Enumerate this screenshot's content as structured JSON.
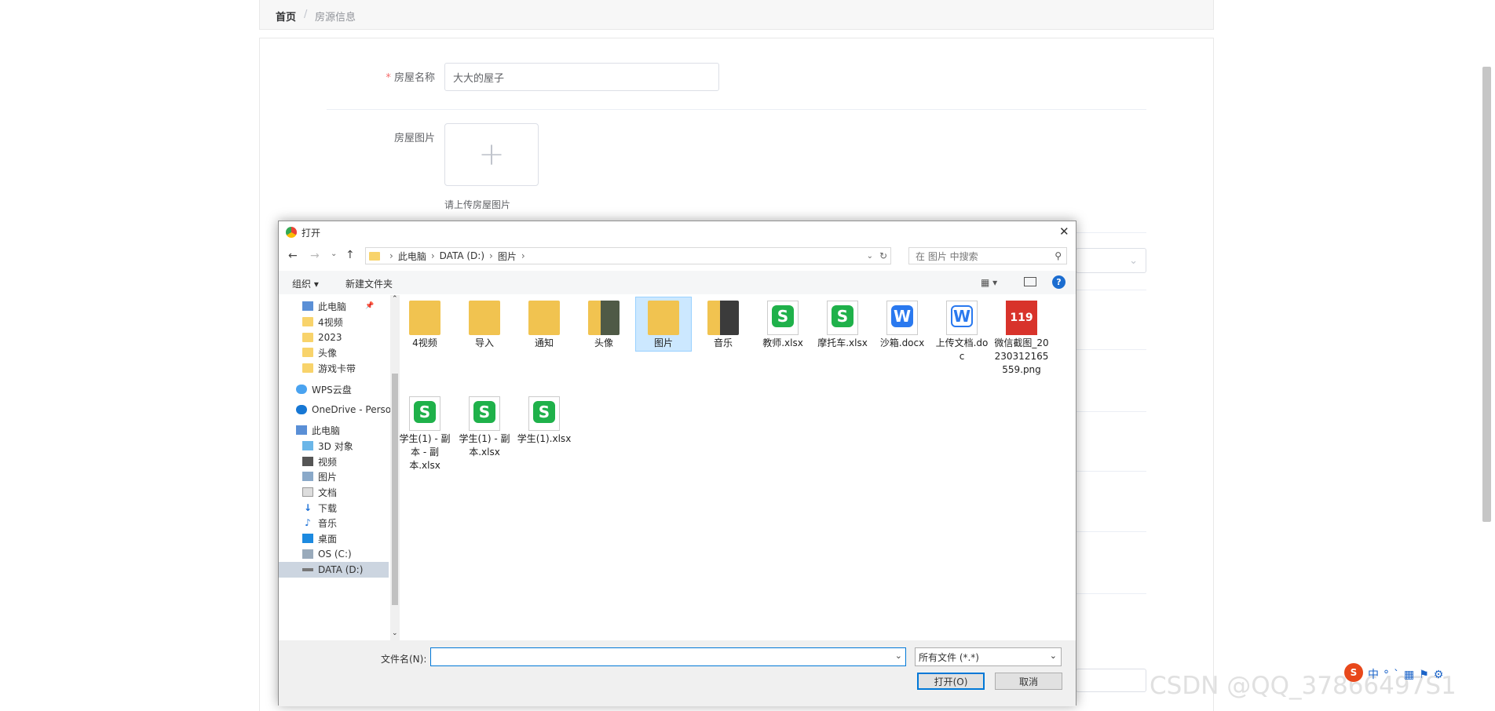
{
  "breadcrumb": {
    "home": "首页",
    "sep": "/",
    "current": "房源信息"
  },
  "form": {
    "name_label": "房屋名称",
    "name_required": "*",
    "name_value": "大大的屋子",
    "image_label": "房屋图片",
    "upload_plus": "+",
    "upload_hint": "请上传房屋图片"
  },
  "dialog": {
    "title": "打开",
    "close": "✕",
    "path": [
      "此电脑",
      "DATA (D:)",
      "图片"
    ],
    "search_placeholder": "在 图片 中搜索",
    "organize": "组织 ▾",
    "new_folder": "新建文件夹",
    "help": "?",
    "nav_items": [
      {
        "label": "此电脑",
        "icon": "pc-icon"
      },
      {
        "label": "4视频",
        "icon": "folder-icon"
      },
      {
        "label": "2023",
        "icon": "folder-icon"
      },
      {
        "label": "头像",
        "icon": "folder-icon"
      },
      {
        "label": "游戏卡带",
        "icon": "folder-icon"
      },
      {
        "label": "WPS云盘",
        "icon": "cloud-icon"
      },
      {
        "label": "OneDrive - Perso",
        "icon": "cloud-icon"
      },
      {
        "label": "此电脑",
        "icon": "pc-icon"
      },
      {
        "label": "3D 对象",
        "icon": "cube-icon"
      },
      {
        "label": "视频",
        "icon": "video-icon"
      },
      {
        "label": "图片",
        "icon": "picture-icon"
      },
      {
        "label": "文档",
        "icon": "document-icon"
      },
      {
        "label": "下载",
        "icon": "download-icon"
      },
      {
        "label": "音乐",
        "icon": "music-icon"
      },
      {
        "label": "桌面",
        "icon": "desktop-icon"
      },
      {
        "label": "OS (C:)",
        "icon": "drive-icon"
      },
      {
        "label": "DATA (D:)",
        "icon": "drive-icon"
      }
    ],
    "files": [
      {
        "name": "4视频",
        "kind": "folder"
      },
      {
        "name": "导入",
        "kind": "folder"
      },
      {
        "name": "通知",
        "kind": "folder"
      },
      {
        "name": "头像",
        "kind": "folder"
      },
      {
        "name": "图片",
        "kind": "folder"
      },
      {
        "name": "音乐",
        "kind": "folder"
      },
      {
        "name": "教师.xlsx",
        "kind": "xlsx"
      },
      {
        "name": "摩托车.xlsx",
        "kind": "xlsx"
      },
      {
        "name": "沙箱.docx",
        "kind": "docx"
      },
      {
        "name": "上传文档.doc",
        "kind": "doc"
      },
      {
        "name": "微信截图_20230312165559.png",
        "kind": "png"
      },
      {
        "name": "学生(1) - 副本 - 副本.xlsx",
        "kind": "xlsx"
      },
      {
        "name": "学生(1) - 副本.xlsx",
        "kind": "xlsx"
      },
      {
        "name": "学生(1).xlsx",
        "kind": "xlsx"
      }
    ],
    "filename_label": "文件名(N):",
    "filename_value": "",
    "filetype": "所有文件 (*.*)",
    "open_btn": "打开(O)",
    "cancel_btn": "取消"
  },
  "watermark": "CSDN @QQ_37866497S1",
  "colors": {
    "accent": "#409eff",
    "selection": "#cce8ff",
    "xlsx": "#1fb14a",
    "docx": "#2a79ef"
  }
}
